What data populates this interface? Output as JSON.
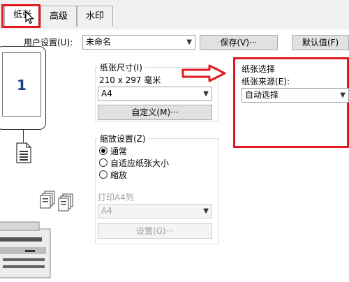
{
  "tabs": [
    {
      "label": "纸张"
    },
    {
      "label": "高级"
    },
    {
      "label": "水印"
    }
  ],
  "user_settings": {
    "label": "用户设置(U):",
    "value": "未命名",
    "save_label": "保存(V)···",
    "default_label": "默认值(F)"
  },
  "preview": {
    "page_number": "1"
  },
  "paper_size": {
    "title": "纸张尺寸(I)",
    "dims": "210 x 297 毫米",
    "value": "A4",
    "custom_label": "自定义(M)···"
  },
  "paper_selection": {
    "title": "纸张选择",
    "source_label": "纸张来源(E):",
    "source_value": "自动选择"
  },
  "scaling": {
    "title": "缩放设置(Z)",
    "options": [
      {
        "label": "通常",
        "selected": true
      },
      {
        "label": "自适应纸张大小",
        "selected": false
      },
      {
        "label": "缩放",
        "selected": false
      }
    ],
    "print_to_label": "打印A4到",
    "print_to_value": "A4",
    "settings_label": "设置(G)···"
  },
  "colors": {
    "highlight": "#e11920",
    "page_number": "#1f3d8a"
  }
}
